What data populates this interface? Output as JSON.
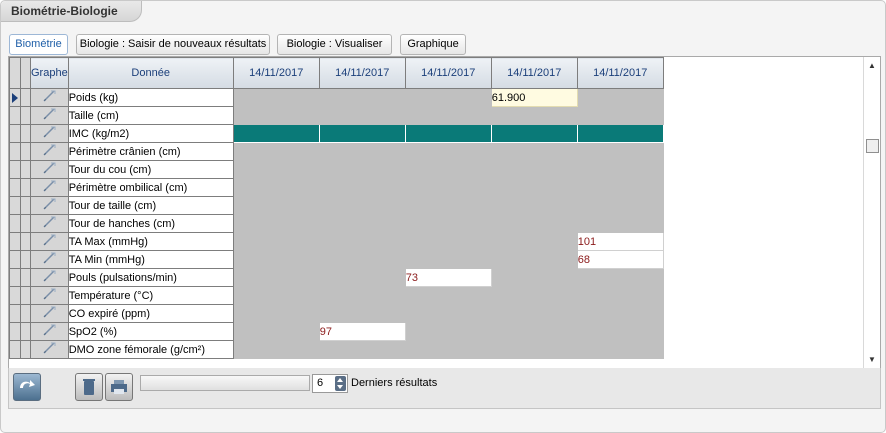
{
  "window": {
    "title": "Biométrie-Biologie"
  },
  "tabs": [
    {
      "label": "Biométrie",
      "active": true
    },
    {
      "label": "Biologie : Saisir de nouveaux résultats",
      "active": false
    },
    {
      "label": "Biologie : Visualiser",
      "active": false
    },
    {
      "label": "Graphique",
      "active": false
    }
  ],
  "grid": {
    "headers": {
      "graph": "Graphe",
      "data": "Donnée"
    },
    "dates": [
      "14/11/2017",
      "14/11/2017",
      "14/11/2017",
      "14/11/2017",
      "14/11/2017"
    ],
    "rows": [
      {
        "label": "Poids (kg)",
        "values": [
          "",
          "",
          "",
          "61.900",
          ""
        ],
        "selected": true
      },
      {
        "label": "Taille (cm)",
        "values": [
          "",
          "",
          "",
          "",
          ""
        ]
      },
      {
        "label": "IMC (kg/m2)",
        "values": [
          "",
          "",
          "",
          "",
          ""
        ],
        "highlight": "teal"
      },
      {
        "label": "Périmètre crânien (cm)",
        "values": [
          "",
          "",
          "",
          "",
          ""
        ]
      },
      {
        "label": "Tour du cou (cm)",
        "values": [
          "",
          "",
          "",
          "",
          ""
        ]
      },
      {
        "label": "Périmètre ombilical (cm)",
        "values": [
          "",
          "",
          "",
          "",
          ""
        ]
      },
      {
        "label": "Tour de taille (cm)",
        "values": [
          "",
          "",
          "",
          "",
          ""
        ]
      },
      {
        "label": "Tour de hanches (cm)",
        "values": [
          "",
          "",
          "",
          "",
          ""
        ]
      },
      {
        "label": "TA Max (mmHg)",
        "values": [
          "",
          "",
          "",
          "",
          "101"
        ]
      },
      {
        "label": "TA Min (mmHg)",
        "values": [
          "",
          "",
          "",
          "",
          "68"
        ]
      },
      {
        "label": "Pouls (pulsations/min)",
        "values": [
          "",
          "",
          "73",
          "",
          ""
        ]
      },
      {
        "label": "Température (°C)",
        "values": [
          "",
          "",
          "",
          "",
          ""
        ]
      },
      {
        "label": "CO expiré (ppm)",
        "values": [
          "",
          "",
          "",
          "",
          ""
        ]
      },
      {
        "label": "SpO2 (%)",
        "values": [
          "",
          "97",
          "",
          "",
          ""
        ]
      },
      {
        "label": "DMO zone fémorale (g/cm²)",
        "values": [
          "",
          "",
          "",
          "",
          ""
        ]
      }
    ]
  },
  "bottom": {
    "count_value": "6",
    "count_label": "Derniers résultats"
  },
  "colors": {
    "teal": "#0a7a78",
    "grey_cell": "#c0c0c0",
    "value_text": "#8b1a1a",
    "edited_cell": "#fffbe1"
  },
  "icons": [
    "refresh-icon",
    "trash-icon",
    "print-icon",
    "graph-pencil-icon",
    "row-selector-arrow-icon",
    "scroll-up-icon",
    "scroll-down-icon"
  ]
}
